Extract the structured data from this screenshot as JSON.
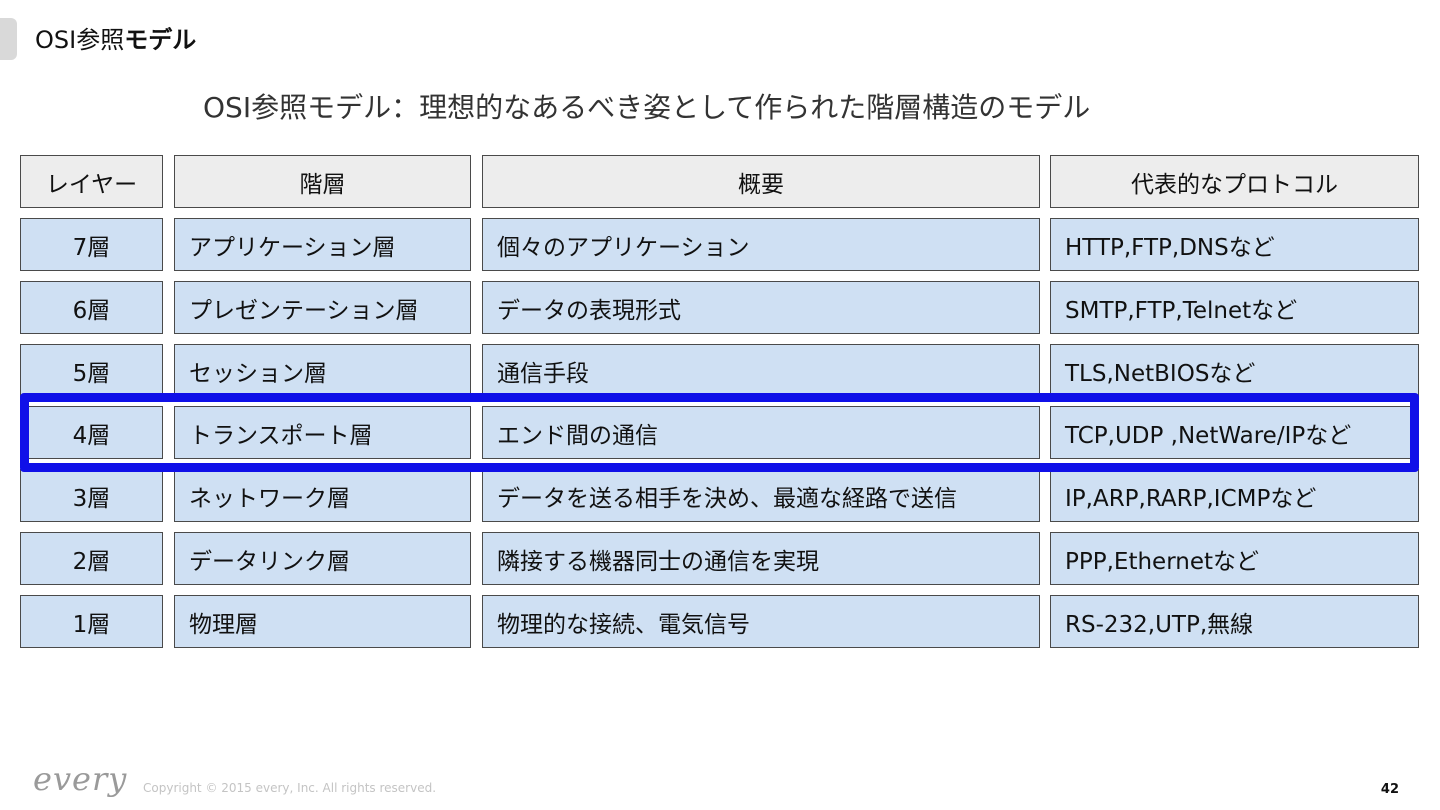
{
  "header": {
    "title_regular": "OSI参照",
    "title_bold": "モデル"
  },
  "subtitle": "OSI参照モデル：理想的なあるべき姿として作られた階層構造のモデル",
  "table": {
    "columns": [
      "レイヤー",
      "階層",
      "概要",
      "代表的なプロトコル"
    ],
    "rows": [
      [
        "7層",
        "アプリケーション層",
        "個々のアプリケーション",
        "HTTP,FTP,DNSなど"
      ],
      [
        "6層",
        "プレゼンテーション層",
        "データの表現形式",
        "SMTP,FTP,Telnetなど"
      ],
      [
        "5層",
        "セッション層",
        "通信手段",
        "TLS,NetBIOSなど"
      ],
      [
        "4層",
        "トランスポート層",
        "エンド間の通信",
        "TCP,UDP ,NetWare/IPなど"
      ],
      [
        "3層",
        "ネットワーク層",
        "データを送る相手を決め、最適な経路で送信",
        "IP,ARP,RARP,ICMPなど"
      ],
      [
        "2層",
        "データリンク層",
        "隣接する機器同士の通信を実現",
        "PPP,Ethernetなど"
      ],
      [
        "1層",
        "物理層",
        "物理的な接続、電気信号",
        "RS-232,UTP,無線"
      ]
    ]
  },
  "footer": {
    "logo": "every",
    "copyright": "Copyright © 2015 every, Inc. All rights reserved.",
    "page_number": "42"
  },
  "colors": {
    "cell_fill": "#cfe0f3",
    "header_fill": "#ededed",
    "highlight": "#1010e8"
  }
}
